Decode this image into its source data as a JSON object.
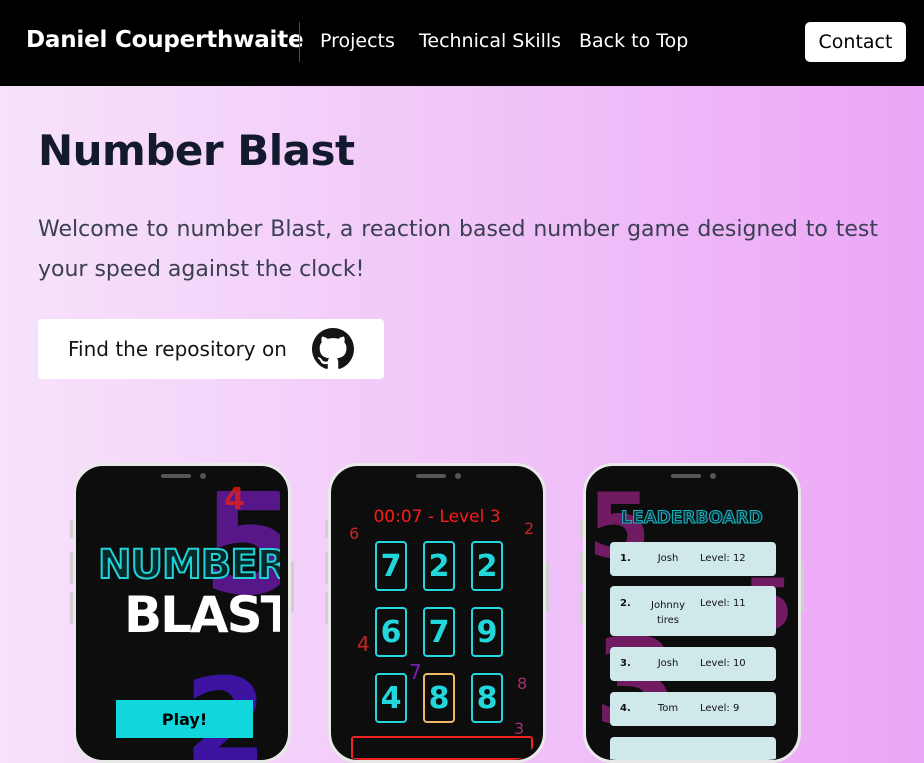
{
  "nav": {
    "brand": "Daniel Couperthwaite",
    "links": [
      "Projects",
      "Technical Skills",
      "Back to Top"
    ],
    "contact": "Contact"
  },
  "hero": {
    "title": "Number Blast",
    "description": "Welcome to number Blast, a reaction based number game designed to test your speed against the clock!",
    "repo_button": "Find the repository on",
    "repo_icon": "github-icon"
  },
  "phones": {
    "home": {
      "logo_top": "NUMBER",
      "logo_bottom": "BLAST",
      "play": "Play!"
    },
    "game": {
      "timer": "00:07 - Level 3",
      "grid": [
        "7",
        "2",
        "2",
        "6",
        "7",
        "9",
        "4",
        "8",
        "8"
      ],
      "selected_index": 7
    },
    "leaderboard": {
      "title": "LEADERBOARD",
      "rows": [
        {
          "rank": "1.",
          "name": "Josh",
          "level": "Level: 12"
        },
        {
          "rank": "2.",
          "name": "Johnny tires",
          "level": "Level: 11"
        },
        {
          "rank": "3.",
          "name": "Josh",
          "level": "Level: 10"
        },
        {
          "rank": "4.",
          "name": "Tom",
          "level": "Level: 9"
        }
      ]
    }
  },
  "colors": {
    "accent_cyan": "#22d7dc",
    "timer_red": "#ff1a1a",
    "bg_purple": "#6b1aa9"
  }
}
